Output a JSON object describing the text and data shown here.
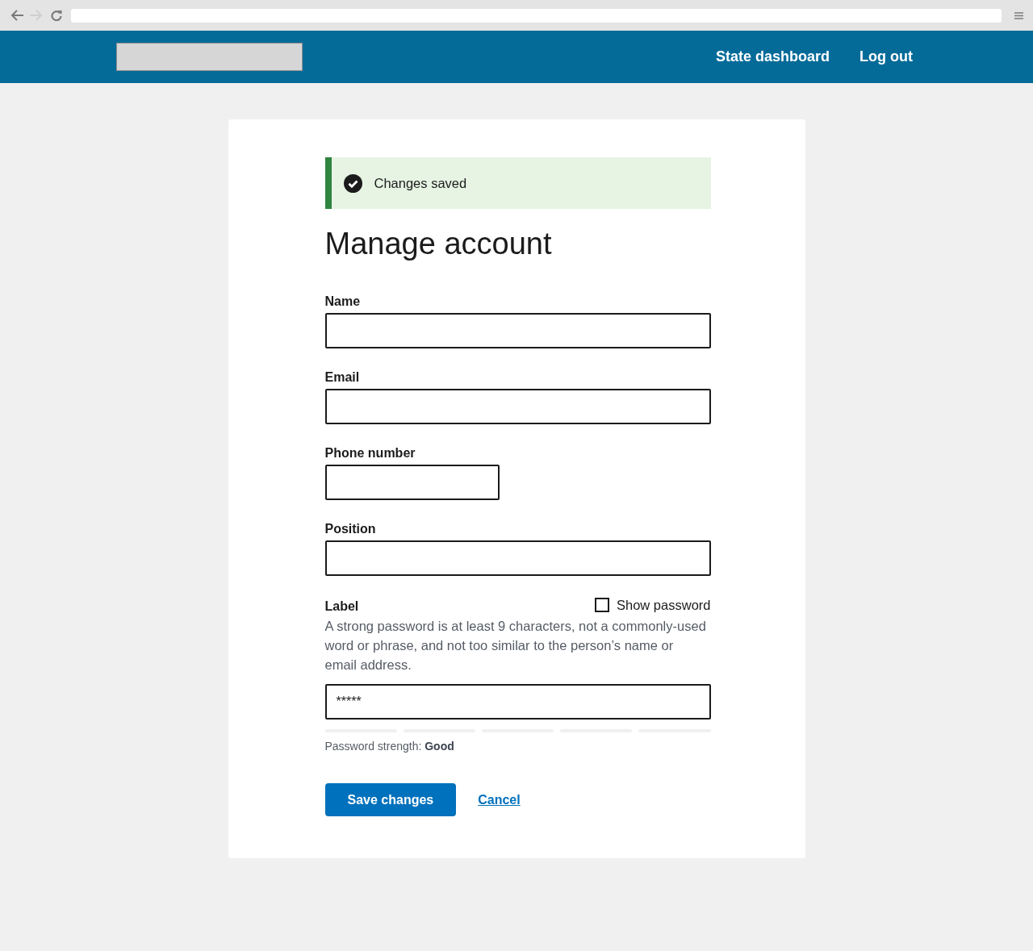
{
  "browser": {
    "nav_buttons": [
      {
        "kind": "back",
        "disabled": false
      },
      {
        "kind": "forward",
        "disabled": true
      },
      {
        "kind": "reload",
        "disabled": false
      }
    ]
  },
  "header": {
    "nav_links": [
      "State dashboard",
      "Log out"
    ]
  },
  "alert": {
    "kind": "success",
    "message": "Changes saved"
  },
  "title": "Manage account",
  "fields": [
    {
      "label": "Name",
      "kind": "wide"
    },
    {
      "label": "Email",
      "kind": "wide"
    },
    {
      "label": "Phone number",
      "kind": "narrow"
    },
    {
      "label": "Position",
      "kind": "wide"
    }
  ],
  "password": {
    "label": "Label",
    "show_password": {
      "label": "Show password",
      "checked": false
    },
    "hint": "A strong password is at least 9 characters, not a commonly-used word or phrase, and not too similar to the person’s name or email address.",
    "value": "*****",
    "strength": {
      "segments": [
        {
          "filled": false
        },
        {
          "filled": false
        },
        {
          "filled": false
        },
        {
          "filled": false
        },
        {
          "filled": false
        }
      ],
      "label": "Password strength: **Good**"
    }
  },
  "actions": {
    "primary": "Save changes",
    "secondary": "Cancel"
  }
}
